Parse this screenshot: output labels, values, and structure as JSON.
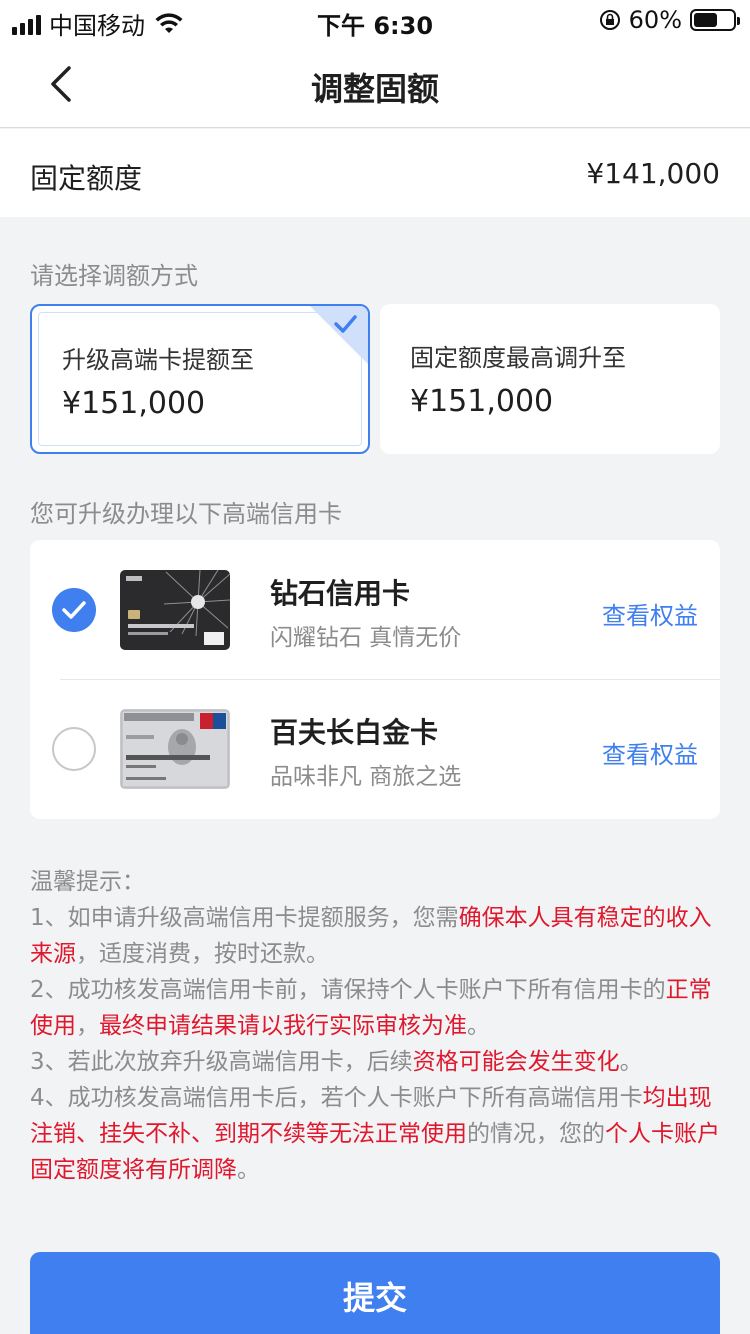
{
  "status_bar": {
    "carrier": "中国移动",
    "time": "下午 6:30",
    "battery_percent": "60%",
    "battery_level": 0.6
  },
  "nav": {
    "title": "调整固额"
  },
  "quota": {
    "label": "固定额度",
    "value": "¥141,000"
  },
  "select_method": {
    "hint": "请选择调额方式",
    "options": [
      {
        "title": "升级高端卡提额至",
        "value": "¥151,000",
        "selected": true
      },
      {
        "title": "固定额度最高调升至",
        "value": "¥151,000",
        "selected": false
      }
    ]
  },
  "cards_section": {
    "hint": "您可升级办理以下高端信用卡",
    "cards": [
      {
        "name": "钻石信用卡",
        "slogan": "闪耀钻石 真情无价",
        "link": "查看权益",
        "selected": true
      },
      {
        "name": "百夫长白金卡",
        "slogan": "品味非凡 商旅之选",
        "link": "查看权益",
        "selected": false
      }
    ]
  },
  "notice": {
    "title": "温馨提示：",
    "items": [
      [
        {
          "text": "1、如申请升级高端信用卡提额服务，您需",
          "red": false
        },
        {
          "text": "确保本人具有稳定的收入来源",
          "red": true
        },
        {
          "text": "，适度消费，按时还款。",
          "red": false
        }
      ],
      [
        {
          "text": "2、成功核发高端信用卡前，请保持个人卡账户下所有信用卡的",
          "red": false
        },
        {
          "text": "正常使用",
          "red": true
        },
        {
          "text": "，",
          "red": false
        },
        {
          "text": "最终申请结果请以我行实际审核为准",
          "red": true
        },
        {
          "text": "。",
          "red": false
        }
      ],
      [
        {
          "text": "3、若此次放弃升级高端信用卡，后续",
          "red": false
        },
        {
          "text": "资格可能会发生变化",
          "red": true
        },
        {
          "text": "。",
          "red": false
        }
      ],
      [
        {
          "text": "4、成功核发高端信用卡后，若个人卡账户下所有高端信用卡",
          "red": false
        },
        {
          "text": "均出现注销、挂失不补、到期不续等无法正常使用",
          "red": true
        },
        {
          "text": "的情况，您的",
          "red": false
        },
        {
          "text": "个人卡账户固定额度将有所调降",
          "red": true
        },
        {
          "text": "。",
          "red": false
        }
      ]
    ]
  },
  "submit": {
    "label": "提交"
  },
  "colors": {
    "accent": "#3f7ff0",
    "warning_red": "#e0182d",
    "muted": "#8c8c8c",
    "background": "#f2f3f5"
  },
  "icons": {
    "signal": "cellular-signal-icon",
    "wifi": "wifi-icon",
    "rotation_lock": "rotation-lock-icon",
    "battery": "battery-icon",
    "back": "chevron-left-icon",
    "check": "checkmark-icon"
  }
}
